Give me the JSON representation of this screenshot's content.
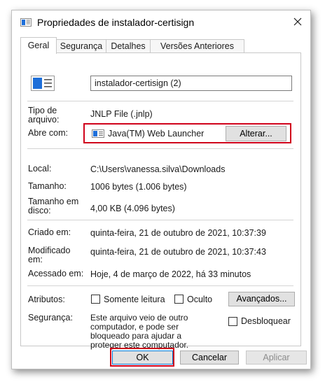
{
  "window": {
    "title": "Propriedades de instalador-certisign"
  },
  "tabs": [
    {
      "label": "Geral"
    },
    {
      "label": "Segurança"
    },
    {
      "label": "Detalhes"
    },
    {
      "label": "Versões Anteriores"
    }
  ],
  "general": {
    "file_name": "instalador-certisign (2)",
    "type_label": "Tipo de arquivo:",
    "type_value": "JNLP File (.jnlp)",
    "opens_with_label": "Abre com:",
    "opens_with_app": "Java(TM) Web Launcher",
    "change_button": "Alterar...",
    "location_label": "Local:",
    "location_value": "C:\\Users\\vanessa.silva\\Downloads",
    "size_label": "Tamanho:",
    "size_value": "1006 bytes (1.006 bytes)",
    "size_on_disk_label": "Tamanho em disco:",
    "size_on_disk_value": "4,00 KB (4.096 bytes)",
    "created_label": "Criado em:",
    "created_value": "quinta-feira, 21 de outubro de 2021, 10:37:39",
    "modified_label": "Modificado em:",
    "modified_value": "quinta-feira, 21 de outubro de 2021, 10:37:43",
    "accessed_label": "Acessado em:",
    "accessed_value": "Hoje, 4 de março de 2022, há 33 minutos",
    "attributes_label": "Atributos:",
    "readonly_label": "Somente leitura",
    "hidden_label": "Oculto",
    "advanced_button": "Avançados...",
    "security_label": "Segurança:",
    "security_line1": "Este arquivo veio de outro",
    "security_line2": "computador, e pode ser",
    "security_line3": "bloqueado para ajudar a",
    "security_line4": "proteger este computador.",
    "unblock_label": "Desbloquear"
  },
  "footer": {
    "ok": "OK",
    "cancel": "Cancelar",
    "apply": "Aplicar"
  },
  "icons": {
    "close": "close-icon",
    "file": "file-icon",
    "app": "java-app-icon"
  },
  "colors": {
    "highlight": "#d0021b",
    "icon_blue": "#1e6fd9"
  }
}
